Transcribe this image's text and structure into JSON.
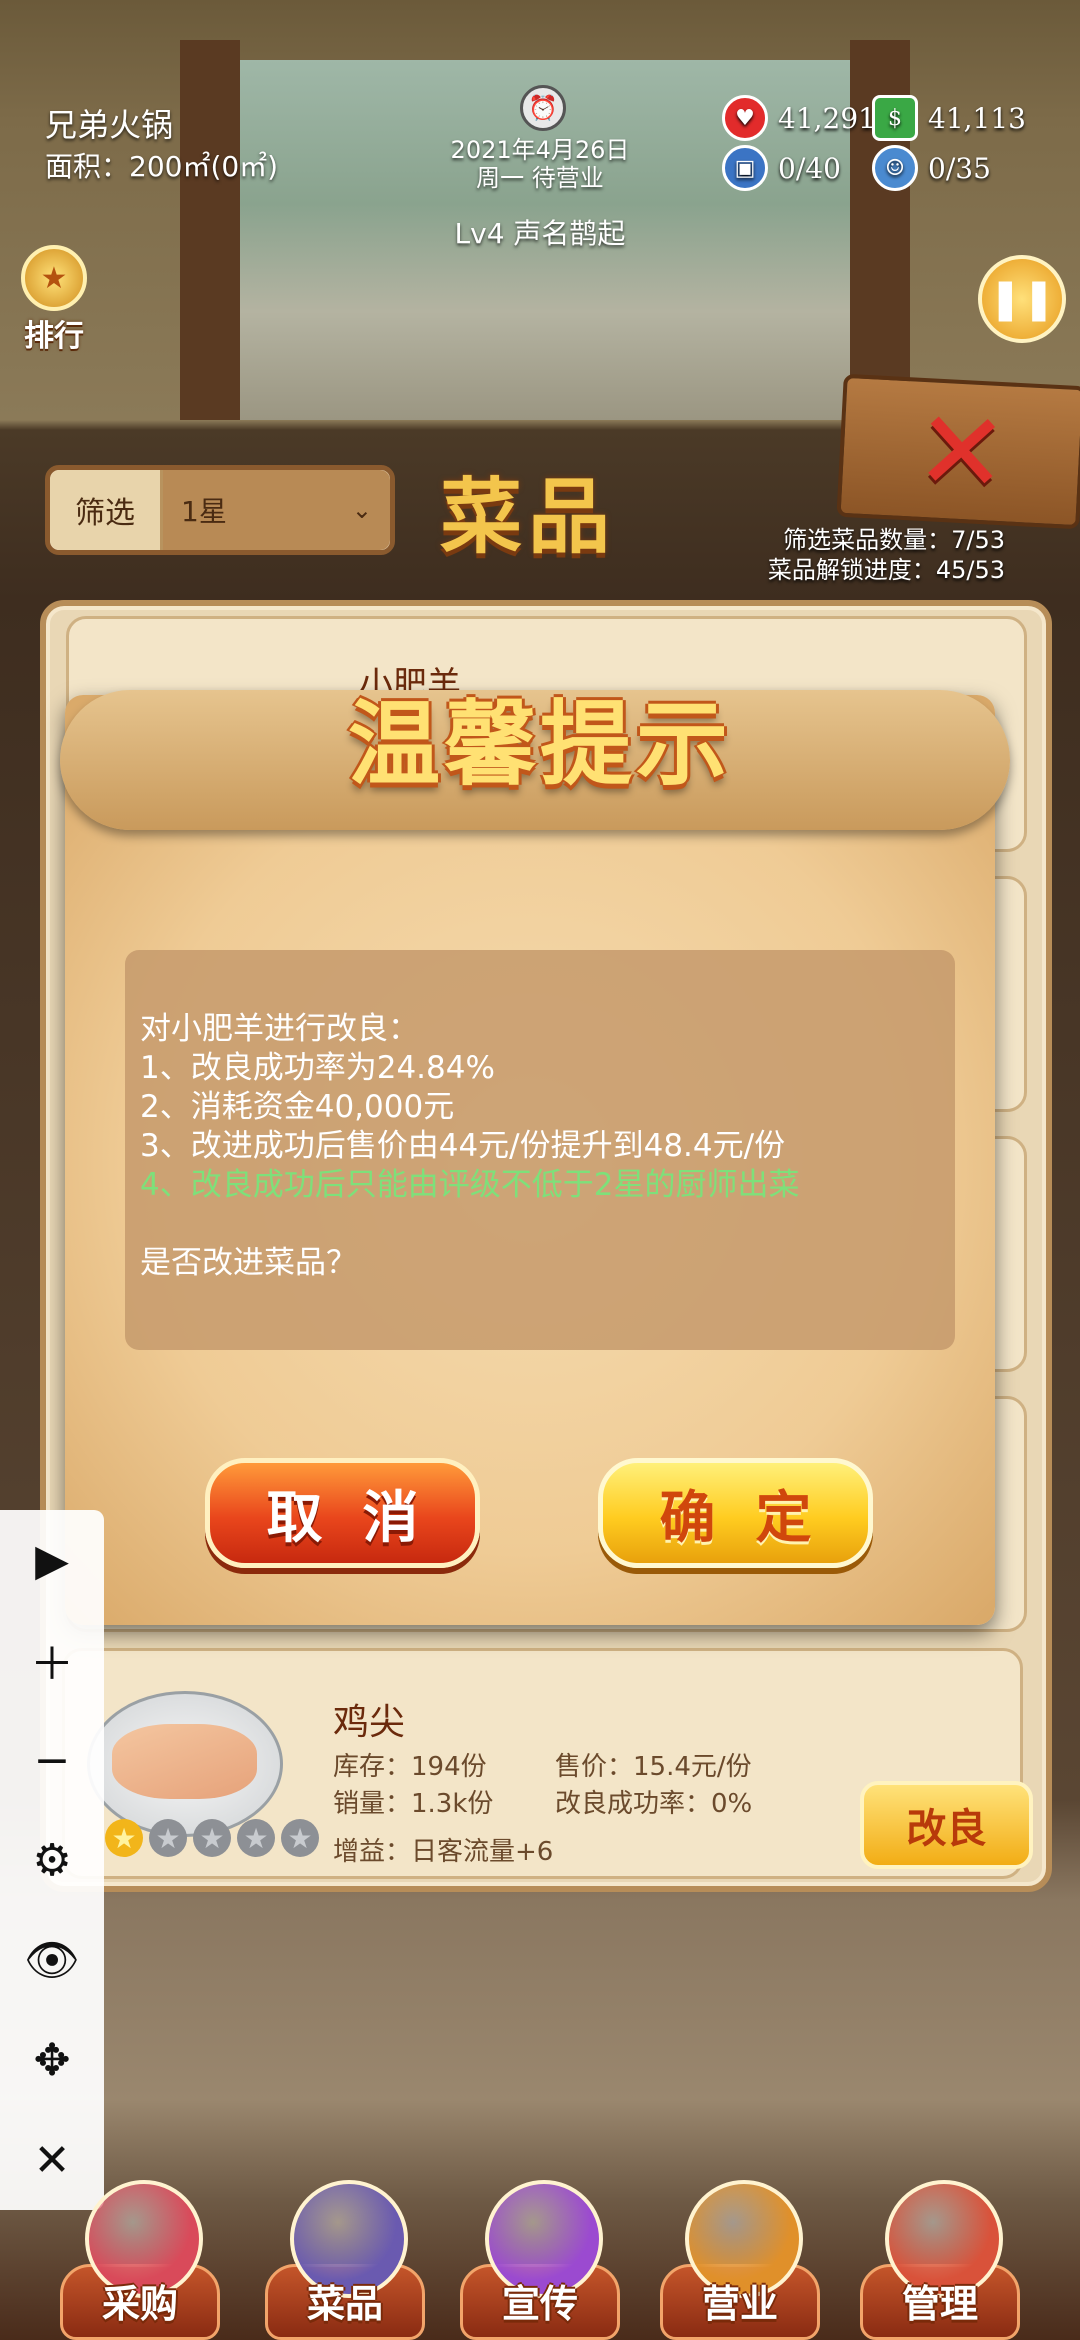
{
  "hud": {
    "shop_name": "兄弟火锅",
    "area": "面积：200㎡(0㎡)",
    "date": "2021年4月26日",
    "status": "周一 待营业",
    "level": "Lv4 声名鹊起",
    "resources": {
      "hearts": "41,291",
      "cash": "41,113",
      "stock": "0/40",
      "staff": "0/35"
    },
    "rank_label": "排行"
  },
  "dishes_page": {
    "title": "菜品",
    "filter_label": "筛选",
    "filter_value": "1星",
    "filter_count": "筛选菜品数量：7/53",
    "unlock_progress": "菜品解锁进度：45/53",
    "first_card_name": "小肥羊"
  },
  "dialog": {
    "title": "温馨提示",
    "lines": [
      "对小肥羊进行改良：",
      "1、改良成功率为24.84%",
      "2、消耗资金40,000元",
      "3、改进成功后售价由44元/份提升到48.4元/份",
      "4、改良成功后只能由评级不低于2星的厨师出菜",
      "",
      "是否改进菜品？"
    ],
    "cancel_label": "取消",
    "confirm_label": "确定"
  },
  "chicken_card": {
    "name": "鸡尖",
    "stock": "库存：194份",
    "price": "售价：15.4元/份",
    "sales": "销量：1.3k份",
    "success_rate": "改良成功率：0%",
    "bonus": "增益：日客流量+6",
    "improve_label": "改良",
    "rating": 1,
    "max_rating": 5
  },
  "toolbar": {
    "icons": [
      "play-icon",
      "zoom-in-icon",
      "zoom-out-icon",
      "gear-icon",
      "eye-icon",
      "move-icon",
      "close-icon"
    ]
  },
  "nav": {
    "items": [
      {
        "label": "采购",
        "color": "#d94a5a"
      },
      {
        "label": "菜品",
        "color": "#6a5ab0"
      },
      {
        "label": "宣传",
        "color": "#9b4ad0"
      },
      {
        "label": "营业",
        "color": "#e0902a"
      },
      {
        "label": "管理",
        "color": "#d9523a"
      }
    ]
  },
  "colors": {
    "accent_gold": "#f3c54c",
    "cancel_red": "#e9461c",
    "confirm_yellow": "#ffcc20",
    "highlight_green": "#7ee07a"
  }
}
